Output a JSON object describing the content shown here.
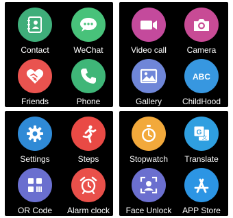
{
  "panels": [
    {
      "apps": [
        {
          "label": "Contact",
          "icon": "contact-book-icon",
          "color": "#3fae7a"
        },
        {
          "label": "WeChat",
          "icon": "chat-bubble-icon",
          "color": "#48c27a"
        },
        {
          "label": "Friends",
          "icon": "handshake-heart-icon",
          "color": "#e9534f"
        },
        {
          "label": "Phone",
          "icon": "phone-icon",
          "color": "#3fb678"
        }
      ]
    },
    {
      "apps": [
        {
          "label": "Video call",
          "icon": "video-camera-icon",
          "color": "#c44a9c"
        },
        {
          "label": "Camera",
          "icon": "camera-icon",
          "color": "#c84b95"
        },
        {
          "label": "Gallery",
          "icon": "image-icon",
          "color": "#6f86d8"
        },
        {
          "label": "ChildHood",
          "icon": "abc-text-icon",
          "color": "#3797e0"
        }
      ]
    },
    {
      "apps": [
        {
          "label": "Settings",
          "icon": "gear-icon",
          "color": "#2f8ad6"
        },
        {
          "label": "Steps",
          "icon": "running-person-icon",
          "color": "#e94a45"
        },
        {
          "label": "OR Code",
          "icon": "qr-code-icon",
          "color": "#6a6fcf"
        },
        {
          "label": "Alarm clock",
          "icon": "alarm-clock-icon",
          "color": "#e9504a"
        }
      ]
    },
    {
      "apps": [
        {
          "label": "Stopwatch",
          "icon": "stopwatch-icon",
          "color": "#f2a93b"
        },
        {
          "label": "Translate",
          "icon": "translate-icon",
          "color": "#2f9fe0"
        },
        {
          "label": "Face Unlock",
          "icon": "face-scan-icon",
          "color": "#6b6fcf"
        },
        {
          "label": "APP Store",
          "icon": "app-store-icon",
          "color": "#2c95e4"
        }
      ]
    }
  ]
}
